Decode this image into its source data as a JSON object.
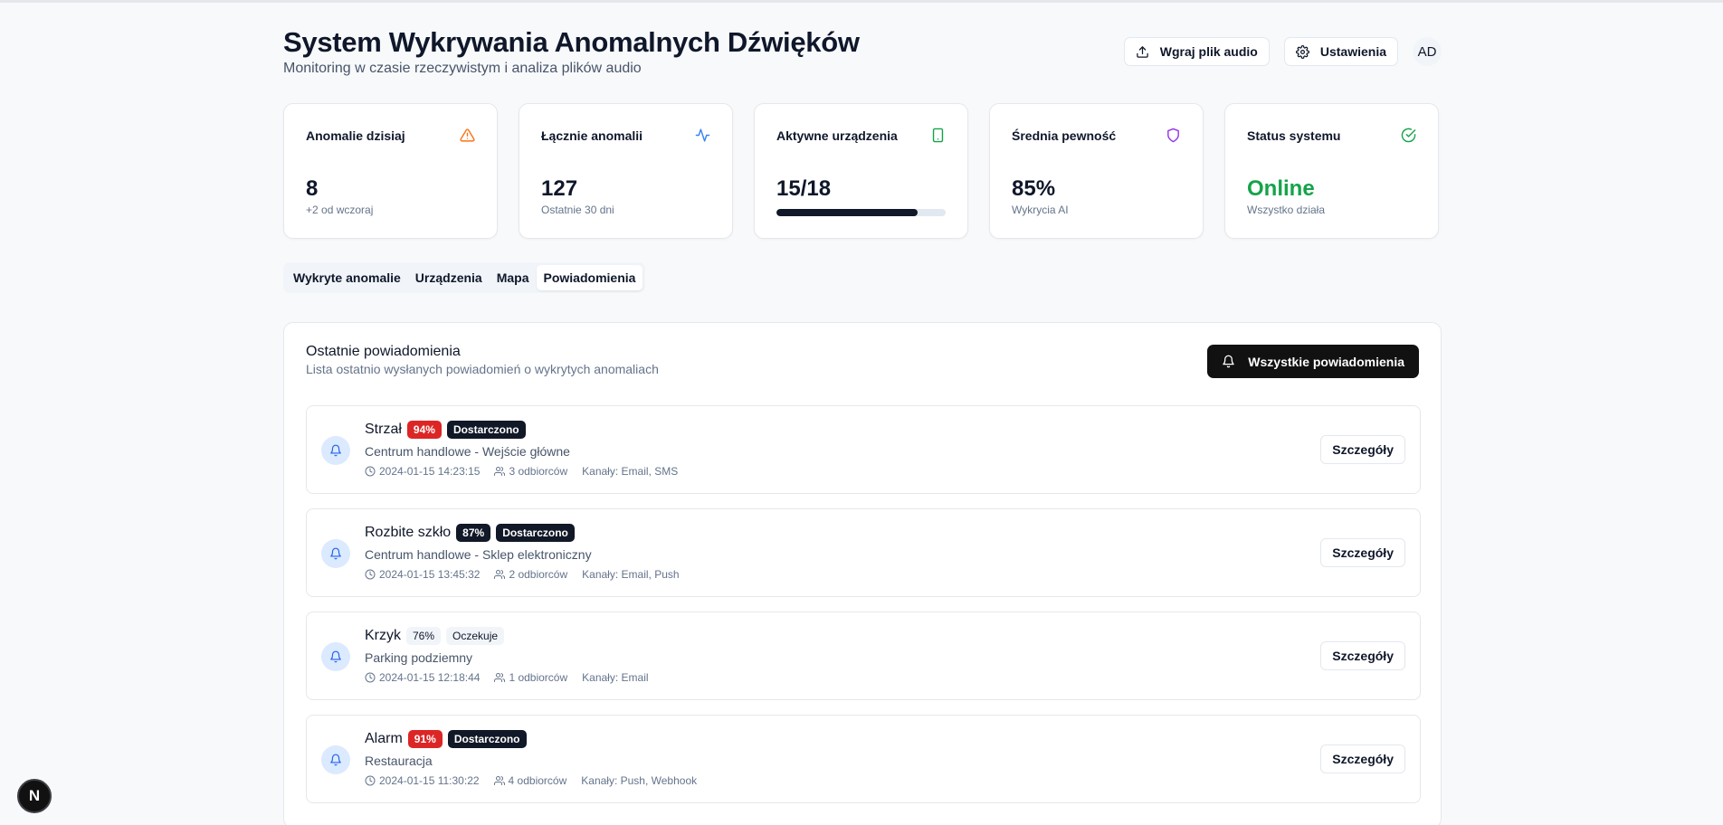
{
  "header": {
    "title": "System Wykrywania Anomalnych Dźwięków",
    "subtitle": "Monitoring w czasie rzeczywistym i analiza plików audio",
    "upload_label": "Wgraj plik audio",
    "settings_label": "Ustawienia",
    "avatar_initials": "AD"
  },
  "stats": [
    {
      "label": "Anomalie dzisiaj",
      "value": "8",
      "sub": "+2 od wczoraj",
      "icon": "alert-triangle-icon",
      "icon_color": "#f97316"
    },
    {
      "label": "Łącznie anomalii",
      "value": "127",
      "sub": "Ostatnie 30 dni",
      "icon": "activity-icon",
      "icon_color": "#3b82f6"
    },
    {
      "label": "Aktywne urządzenia",
      "value": "15/18",
      "progress": 0.833,
      "icon": "smartphone-icon",
      "icon_color": "#16a34a"
    },
    {
      "label": "Średnia pewność",
      "value": "85%",
      "sub": "Wykrycia AI",
      "icon": "shield-icon",
      "icon_color": "#9333ea"
    },
    {
      "label": "Status systemu",
      "value": "Online",
      "sub": "Wszystko działa",
      "icon": "check-circle-icon",
      "icon_color": "#16a34a"
    }
  ],
  "tabs": [
    {
      "label": "Wykryte anomalie",
      "active": false
    },
    {
      "label": "Urządzenia",
      "active": false
    },
    {
      "label": "Mapa",
      "active": false
    },
    {
      "label": "Powiadomienia",
      "active": true
    }
  ],
  "panel": {
    "title": "Ostatnie powiadomienia",
    "description": "Lista ostatnio wysłanych powiadomień o wykrytych anomaliach",
    "all_button_label": "Wszystkie powiadomienia",
    "details_label": "Szczegóły"
  },
  "notifications": [
    {
      "title": "Strzał",
      "confidence": "94%",
      "confidence_style": "red",
      "status": "Dostarczono",
      "status_style": "dark",
      "location": "Centrum handlowe - Wejście główne",
      "time": "2024-01-15 14:23:15",
      "recipients": "3 odbiorców",
      "channels": "Kanały: Email, SMS"
    },
    {
      "title": "Rozbite szkło",
      "confidence": "87%",
      "confidence_style": "dark",
      "status": "Dostarczono",
      "status_style": "dark",
      "location": "Centrum handlowe - Sklep elektroniczny",
      "time": "2024-01-15 13:45:32",
      "recipients": "2 odbiorców",
      "channels": "Kanały: Email, Push"
    },
    {
      "title": "Krzyk",
      "confidence": "76%",
      "confidence_style": "grey",
      "status": "Oczekuje",
      "status_style": "grey",
      "location": "Parking podziemny",
      "time": "2024-01-15 12:18:44",
      "recipients": "1 odbiorców",
      "channels": "Kanały: Email"
    },
    {
      "title": "Alarm",
      "confidence": "91%",
      "confidence_style": "red",
      "status": "Dostarczono",
      "status_style": "dark",
      "location": "Restauracja",
      "time": "2024-01-15 11:30:22",
      "recipients": "4 odbiorców",
      "channels": "Kanały: Push, Webhook"
    }
  ],
  "dev_badge": "N"
}
